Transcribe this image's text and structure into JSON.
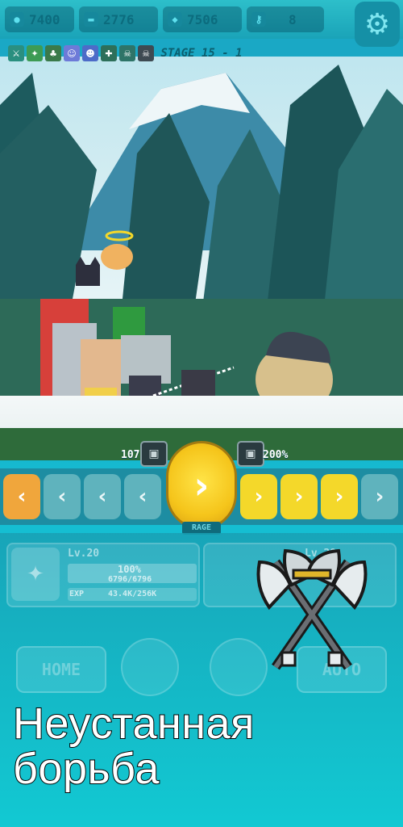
{
  "topbar": {
    "currencies": [
      {
        "icon": "coin-icon",
        "value": "7400"
      },
      {
        "icon": "ticket-icon",
        "value": "2776"
      },
      {
        "icon": "gem-icon",
        "value": "7506"
      },
      {
        "icon": "key-icon",
        "value": "8"
      }
    ],
    "settings_icon": "gear-icon"
  },
  "stage": {
    "label": "STAGE 15 - 1"
  },
  "skillbar": {
    "left_percent": "107",
    "right_percent": "200%",
    "rage_label": "RAGE",
    "left_arrows": [
      "‹",
      "‹",
      "‹",
      "‹"
    ],
    "right_arrows": [
      "›",
      "›",
      "›",
      "›"
    ],
    "rage_arrow": "›"
  },
  "hero_panel": {
    "level": "Lv.20",
    "hp_percent": "100%",
    "hp_value": "6796/6796",
    "exp_label": "EXP",
    "exp_value": "43.4K/256K",
    "level_right": "Lv.29"
  },
  "nav": {
    "home_label": "HOME",
    "auto_label": "AUTO"
  },
  "promo": {
    "line1": "Неустанная",
    "line2": "борьба"
  },
  "colors": {
    "accent": "#f4d82a",
    "bg": "#16b8cf",
    "rage": "#f5c51b"
  }
}
